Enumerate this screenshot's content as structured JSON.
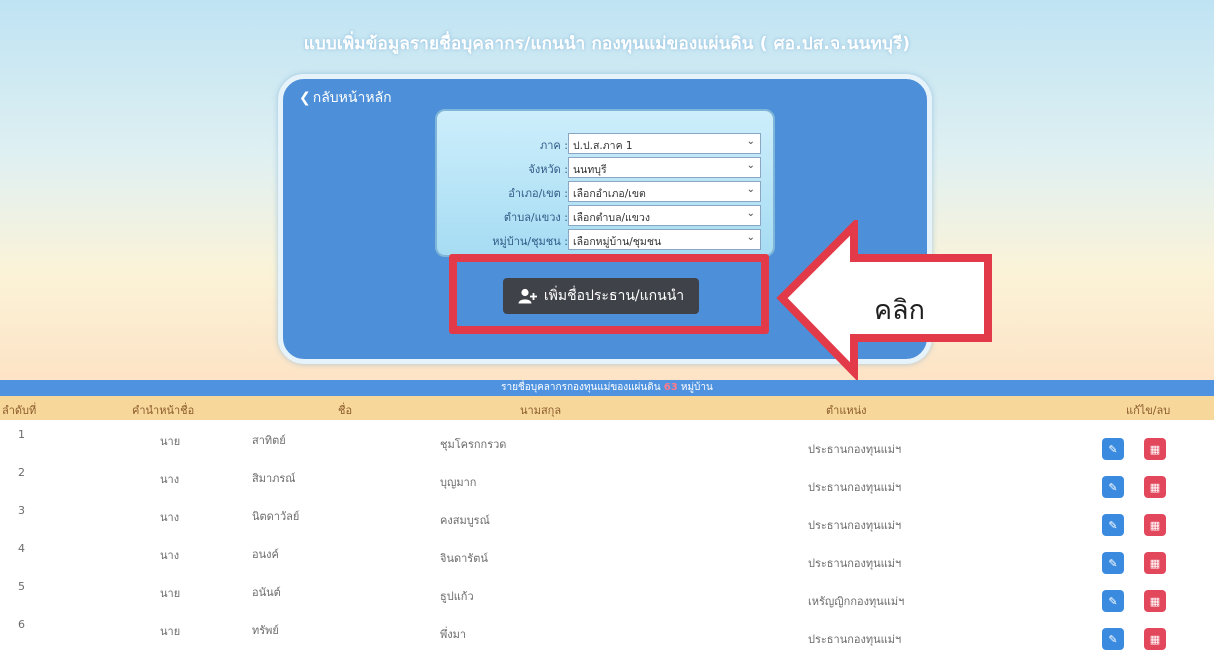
{
  "page": {
    "title": "แบบเพิ่มข้อมูลรายชื่อบุคลากร/แกนนำ กองทุนแม่ของแผ่นดิน ( ศอ.ปส.จ.นนทบุรี)",
    "back_label": "กลับหน้าหลัก"
  },
  "filters": [
    {
      "label": "ภาค :",
      "value": "ป.ป.ส.ภาค 1"
    },
    {
      "label": "จังหวัด :",
      "value": "นนทบุรี"
    },
    {
      "label": "อำเภอ/เขต :",
      "value": "เลือกอำเภอ/เขต"
    },
    {
      "label": "ตำบล/แขวง :",
      "value": "เลือกตำบล/แขวง"
    },
    {
      "label": "หมู่บ้าน/ชุมชน :",
      "value": "เลือกหมู่บ้าน/ชุมชน"
    }
  ],
  "add_button": {
    "label": "เพิ่มชื่อประธาน/แกนนำ",
    "icon": "user-plus-icon"
  },
  "callout": {
    "text": "คลิก",
    "highlight_color": "#e23a48"
  },
  "caption": {
    "prefix": "รายชื่อบุคลากรกองทุนแม่ของแผ่นดิน",
    "count": "63",
    "suffix": "หมู่บ้าน"
  },
  "table": {
    "headers": [
      "ลำดับที่",
      "คำนำหน้าชื่อ",
      "ชื่อ",
      "นามสกุล",
      "ตำแหน่ง",
      "แก้ไข/ลบ"
    ],
    "rows": [
      {
        "no": "1",
        "prefix": "นาย",
        "first": "สาทิตย์",
        "last": "ชุมโครกกรวด",
        "position": "ประธานกองทุนแม่ฯ"
      },
      {
        "no": "2",
        "prefix": "นาง",
        "first": "สิมาภรณ์",
        "last": "บุญมาก",
        "position": "ประธานกองทุนแม่ฯ"
      },
      {
        "no": "3",
        "prefix": "นาง",
        "first": "นิตดาวัลย์",
        "last": "คงสมบูรณ์",
        "position": "ประธานกองทุนแม่ฯ"
      },
      {
        "no": "4",
        "prefix": "นาง",
        "first": "อนงค์",
        "last": "จินดารัตน์",
        "position": "ประธานกองทุนแม่ฯ"
      },
      {
        "no": "5",
        "prefix": "นาย",
        "first": "อนันต์",
        "last": "ธูปแก้ว",
        "position": "เหรัญญิกกองทุนแม่ฯ"
      },
      {
        "no": "6",
        "prefix": "นาย",
        "first": "ทรัพย์",
        "last": "พึ่งมา",
        "position": "ประธานกองทุนแม่ฯ"
      }
    ]
  },
  "colors": {
    "panel": "#4d8fd8",
    "header_bar": "#4f92df",
    "edit": "#3a8be0",
    "delete": "#e2475c"
  }
}
